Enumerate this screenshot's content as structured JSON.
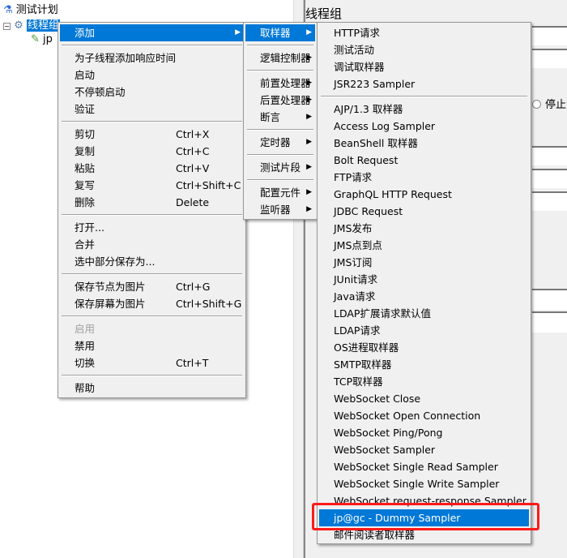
{
  "tree": {
    "root": "测试计划",
    "thread_group": "线程组",
    "child": "jp"
  },
  "right_panel": {
    "title": "线程组",
    "radio_label": "停止测"
  },
  "context_menu": {
    "items": [
      {
        "label": "添加",
        "submenu": true,
        "highlighted": true
      },
      {
        "sep": true
      },
      {
        "label": "为子线程添加响应时间"
      },
      {
        "label": "启动"
      },
      {
        "label": "不停顿启动"
      },
      {
        "label": "验证"
      },
      {
        "sep": true
      },
      {
        "label": "剪切",
        "shortcut": "Ctrl+X"
      },
      {
        "label": "复制",
        "shortcut": "Ctrl+C"
      },
      {
        "label": "粘贴",
        "shortcut": "Ctrl+V"
      },
      {
        "label": "复写",
        "shortcut": "Ctrl+Shift+C"
      },
      {
        "label": "删除",
        "shortcut": "Delete"
      },
      {
        "sep": true
      },
      {
        "label": "打开..."
      },
      {
        "label": "合并"
      },
      {
        "label": "选中部分保存为..."
      },
      {
        "sep": true
      },
      {
        "label": "保存节点为图片",
        "shortcut": "Ctrl+G"
      },
      {
        "label": "保存屏幕为图片",
        "shortcut": "Ctrl+Shift+G"
      },
      {
        "sep": true
      },
      {
        "label": "启用",
        "disabled": true
      },
      {
        "label": "禁用"
      },
      {
        "label": "切换",
        "shortcut": "Ctrl+T"
      },
      {
        "sep": true
      },
      {
        "label": "帮助"
      }
    ]
  },
  "add_submenu": {
    "items": [
      {
        "label": "取样器",
        "submenu": true,
        "highlighted": true
      },
      {
        "sep": true
      },
      {
        "label": "逻辑控制器",
        "submenu": true
      },
      {
        "sep": true
      },
      {
        "label": "前置处理器",
        "submenu": true
      },
      {
        "label": "后置处理器",
        "submenu": true
      },
      {
        "label": "断言",
        "submenu": true
      },
      {
        "sep": true
      },
      {
        "label": "定时器",
        "submenu": true
      },
      {
        "sep": true
      },
      {
        "label": "测试片段",
        "submenu": true
      },
      {
        "sep": true
      },
      {
        "label": "配置元件",
        "submenu": true
      },
      {
        "label": "监听器",
        "submenu": true
      }
    ]
  },
  "sampler_submenu": {
    "items": [
      {
        "label": "HTTP请求"
      },
      {
        "label": "测试活动"
      },
      {
        "label": "调试取样器"
      },
      {
        "label": "JSR223 Sampler"
      },
      {
        "sep": true
      },
      {
        "label": "AJP/1.3 取样器"
      },
      {
        "label": "Access Log Sampler"
      },
      {
        "label": "BeanShell 取样器"
      },
      {
        "label": "Bolt Request"
      },
      {
        "label": "FTP请求"
      },
      {
        "label": "GraphQL HTTP Request"
      },
      {
        "label": "JDBC Request"
      },
      {
        "label": "JMS发布"
      },
      {
        "label": "JMS点到点"
      },
      {
        "label": "JMS订阅"
      },
      {
        "label": "JUnit请求"
      },
      {
        "label": "Java请求"
      },
      {
        "label": "LDAP扩展请求默认值"
      },
      {
        "label": "LDAP请求"
      },
      {
        "label": "OS进程取样器"
      },
      {
        "label": "SMTP取样器"
      },
      {
        "label": "TCP取样器"
      },
      {
        "label": "WebSocket Close"
      },
      {
        "label": "WebSocket Open Connection"
      },
      {
        "label": "WebSocket Ping/Pong"
      },
      {
        "label": "WebSocket Sampler"
      },
      {
        "label": "WebSocket Single Read Sampler"
      },
      {
        "label": "WebSocket Single Write Sampler"
      },
      {
        "label": "WebSocket request-response Sampler"
      },
      {
        "label": "jp@gc - Dummy Sampler",
        "highlighted": true
      },
      {
        "label": "邮件阅读者取样器"
      }
    ]
  },
  "colors": {
    "highlight": "#0078d7",
    "annotation": "#ff1a1a"
  },
  "icons": {
    "test_plan": "flask-icon",
    "thread_group": "gear-icon",
    "sampler": "pipette-icon",
    "submenu": "caret-right-icon"
  }
}
